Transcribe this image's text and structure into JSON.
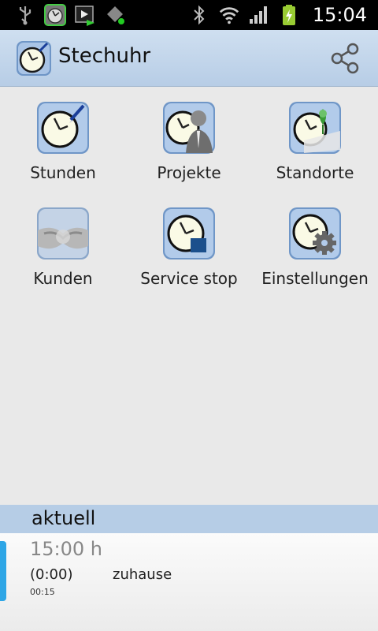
{
  "status_bar": {
    "left_icons": [
      "usb-icon",
      "clock-app-icon",
      "media-player-icon",
      "gps-icon"
    ],
    "right_icons": [
      "bluetooth-icon",
      "wifi-icon",
      "signal-icon",
      "battery-charging-icon"
    ],
    "time": "15:04"
  },
  "action_bar": {
    "title": "Stechuhr",
    "share_icon": "share-icon",
    "background": "#b7cde6"
  },
  "tiles": [
    {
      "label": "Stunden",
      "icon": "clock-pen-icon"
    },
    {
      "label": "Projekte",
      "icon": "clock-person-icon"
    },
    {
      "label": "Standorte",
      "icon": "clock-location-icon"
    },
    {
      "label": "Kunden",
      "icon": "handshake-icon"
    },
    {
      "label": "Service stop",
      "icon": "clock-stop-icon"
    },
    {
      "label": "Einstellungen",
      "icon": "clock-gear-icon"
    }
  ],
  "current": {
    "header": "aktuell",
    "time": "15:00 h",
    "duration": "(0:00)",
    "place": "zuhause",
    "elapsed": "00:15",
    "accent": "#2ea6e6"
  }
}
